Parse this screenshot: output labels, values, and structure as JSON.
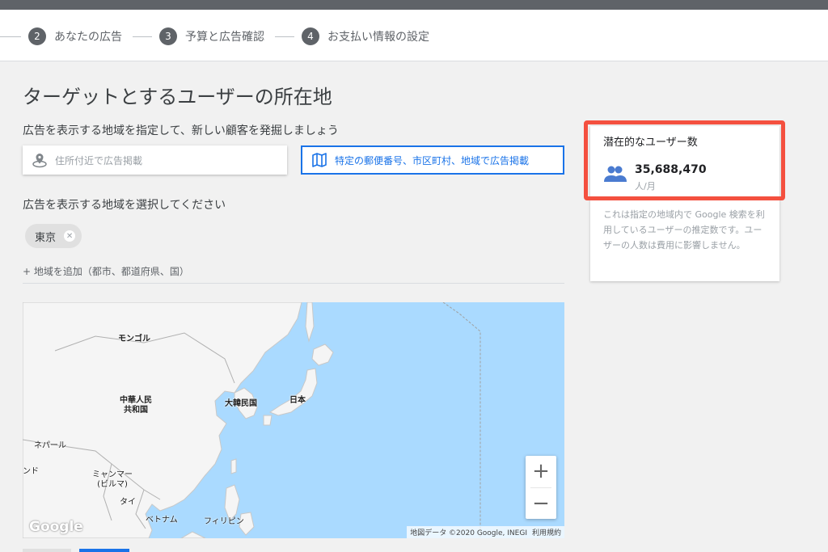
{
  "stepper": {
    "steps": [
      {
        "num": "2",
        "label": "あなたの広告"
      },
      {
        "num": "3",
        "label": "予算と広告確認"
      },
      {
        "num": "4",
        "label": "お支払い情報の設定"
      }
    ]
  },
  "page": {
    "title": "ターゲットとするユーザーの所在地",
    "instruction": "広告を表示する地域を指定して、新しい顧客を発掘しましょう",
    "option_nearby": "住所付近で広告掲載",
    "option_region": "特定の郵便番号、市区町村、地域で広告掲載",
    "select_prompt": "広告を表示する地域を選択してください",
    "selected_chip": "東京",
    "add_location": "+ 地域を追加（都市、都道府県、国）"
  },
  "map": {
    "labels": {
      "mongolia": "モンゴル",
      "china": "中華人民\n共和国",
      "korea": "大韓民国",
      "japan": "日本",
      "nepal": "ネパール",
      "india": "ンド",
      "myanmar": "ミャンマー\n(ビルマ)",
      "thailand": "タイ",
      "vietnam": "ベトナム",
      "philippines": "フィリピン"
    },
    "google_logo": "Google",
    "attribution": "地図データ ©2020 Google, INEGI",
    "terms": "利用規約",
    "zoom_in": "+",
    "zoom_out": "−"
  },
  "audience": {
    "title": "潜在的なユーザー数",
    "count": "35,688,470",
    "unit": "人/月",
    "description": "これは指定の地域内で Google 検索を利用しているユーザーの推定数です。ユーザーの人数は費用に影響しません。"
  },
  "colors": {
    "accent": "#1a73e8",
    "highlight": "#f4503f",
    "water": "#aadaff",
    "land": "#f5f5f5"
  }
}
